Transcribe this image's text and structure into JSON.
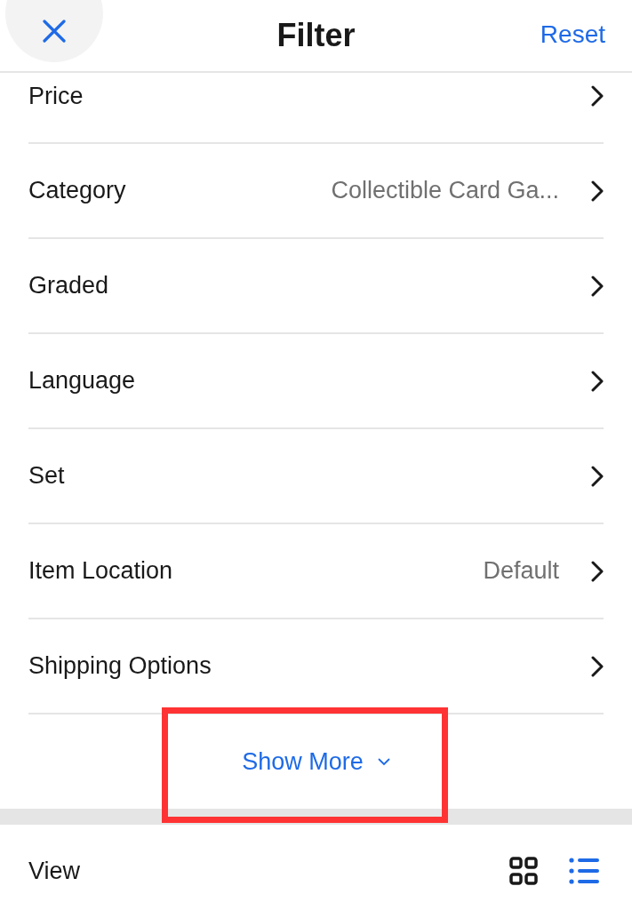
{
  "header": {
    "title": "Filter",
    "reset": "Reset"
  },
  "filters": [
    {
      "label": "Price"
    },
    {
      "label": "Category",
      "value": "Collectible Card Ga..."
    },
    {
      "label": "Graded"
    },
    {
      "label": "Language"
    },
    {
      "label": "Set"
    },
    {
      "label": "Item Location",
      "value": "Default"
    },
    {
      "label": "Shipping Options"
    }
  ],
  "show_more": {
    "label": "Show More",
    "highlighted": true
  },
  "view": {
    "label": "View",
    "options": [
      {
        "kind": "grid",
        "selected": false
      },
      {
        "kind": "list",
        "selected": true
      }
    ]
  }
}
